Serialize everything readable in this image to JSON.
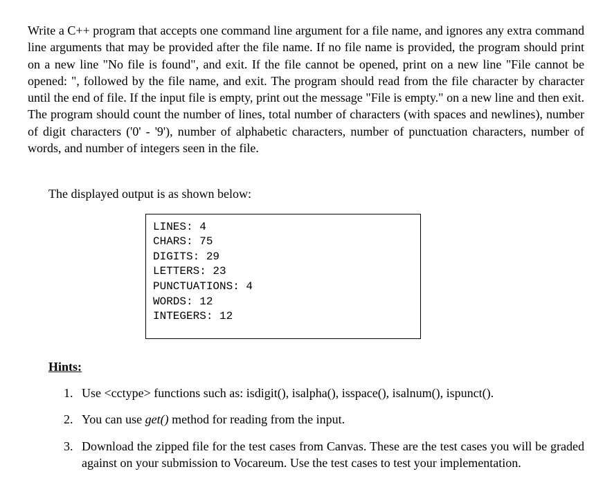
{
  "main_paragraph": "Write a C++ program that accepts one command line argument for a file name, and ignores any extra command line arguments that may be provided after the file name. If no file name is provided, the program should print on a new line \"No file is found\", and exit. If the file cannot be opened, print on a new line \"File cannot be opened: \", followed by the file name, and exit. The program should read from the file character by character until the end of file. If the input file is empty, print out the message \"File is empty.\" on a new line and then exit. The program should count the number of lines, total number of characters (with spaces and newlines), number of digit characters ('0' - '9'), number of alphabetic characters, number of punctuation characters, number of words, and number of integers seen in the file.",
  "output_intro": "The displayed output is as shown below:",
  "output_lines": {
    "l0": "LINES: 4",
    "l1": "CHARS: 75",
    "l2": "DIGITS: 29",
    "l3": "LETTERS: 23",
    "l4": "PUNCTUATIONS: 4",
    "l5": "WORDS: 12",
    "l6": "INTEGERS: 12"
  },
  "hints_heading": "Hints:",
  "hints": {
    "h1_a": "Use <cctype> functions such as: isdigit(), isalpha(), isspace(), isalnum(), ispunct().",
    "h2_a": "You can use ",
    "h2_b": "get()",
    "h2_c": " method for reading from the input.",
    "h3_a": "Download the zipped file for the test cases from Canvas. These are the test cases you will be graded against on your submission to Vocareum. Use the test cases to test your implementation."
  }
}
